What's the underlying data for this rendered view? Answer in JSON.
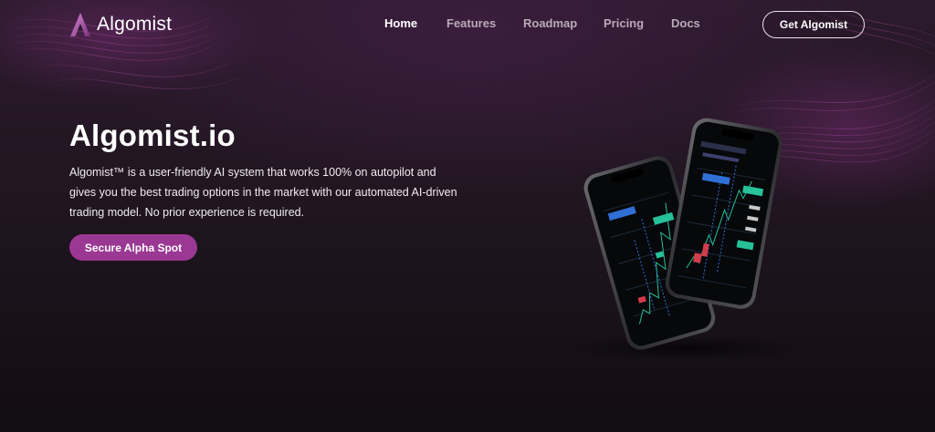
{
  "header": {
    "brand": "Algomist",
    "nav": [
      {
        "label": "Home",
        "active": true
      },
      {
        "label": "Features",
        "active": false
      },
      {
        "label": "Roadmap",
        "active": false
      },
      {
        "label": "Pricing",
        "active": false
      },
      {
        "label": "Docs",
        "active": false
      }
    ],
    "cta_label": "Get Algomist"
  },
  "hero": {
    "title": "Algomist.io",
    "description": "Algomist™ is a user-friendly AI system that works 100% on autopilot and gives you the best trading options in the market with our automated AI-driven trading model. No prior experience is required.",
    "cta_label": "Secure Alpha Spot"
  },
  "colors": {
    "accent": "#9a3893",
    "background": "#221622",
    "nav_inactive": "#b9aab8",
    "logo_gradient_start": "#c67fc4",
    "logo_gradient_end": "#8a3a8c"
  },
  "icons": {
    "logo": "algomist-logo-icon"
  }
}
